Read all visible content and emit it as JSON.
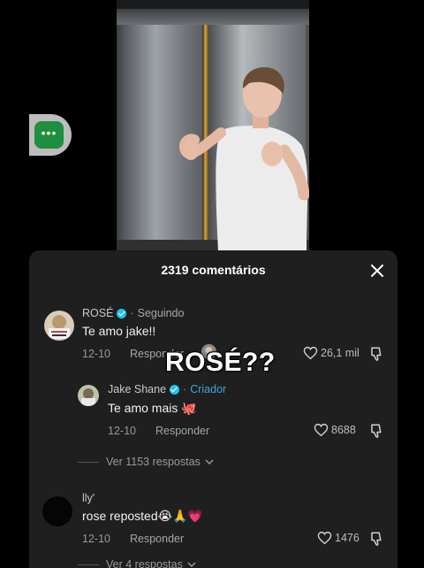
{
  "overlay": {
    "caption": "ROSÉ??"
  },
  "side_button": {
    "icon": "more-dots-icon",
    "color": "#1e8f3f"
  },
  "comments_sheet": {
    "title": "2319 comentários",
    "close_icon": "close-icon",
    "comments": [
      {
        "author": "ROSÉ",
        "verified": true,
        "relation": "Seguindo",
        "text": "Te amo jake!!",
        "date": "12-10",
        "reply_label": "Responder",
        "likes": "26,1 mil"
      },
      {
        "author": "Jake Shane",
        "verified": true,
        "relation": "Criador",
        "text": "Te amo mais 🐙",
        "date": "12-10",
        "reply_label": "Responder",
        "likes": "8688"
      },
      {
        "author": "lly'",
        "text": "rose reposted😭🙏💗",
        "date": "12-10",
        "reply_label": "Responder",
        "likes": "1476"
      }
    ],
    "view_replies_1": "Ver 1153 respostas",
    "view_replies_2": "Ver 4 respostas"
  },
  "colors": {
    "sheet_bg": "#1f1f1f",
    "verified": "#20c5ee",
    "creator": "#3aa7dc"
  }
}
